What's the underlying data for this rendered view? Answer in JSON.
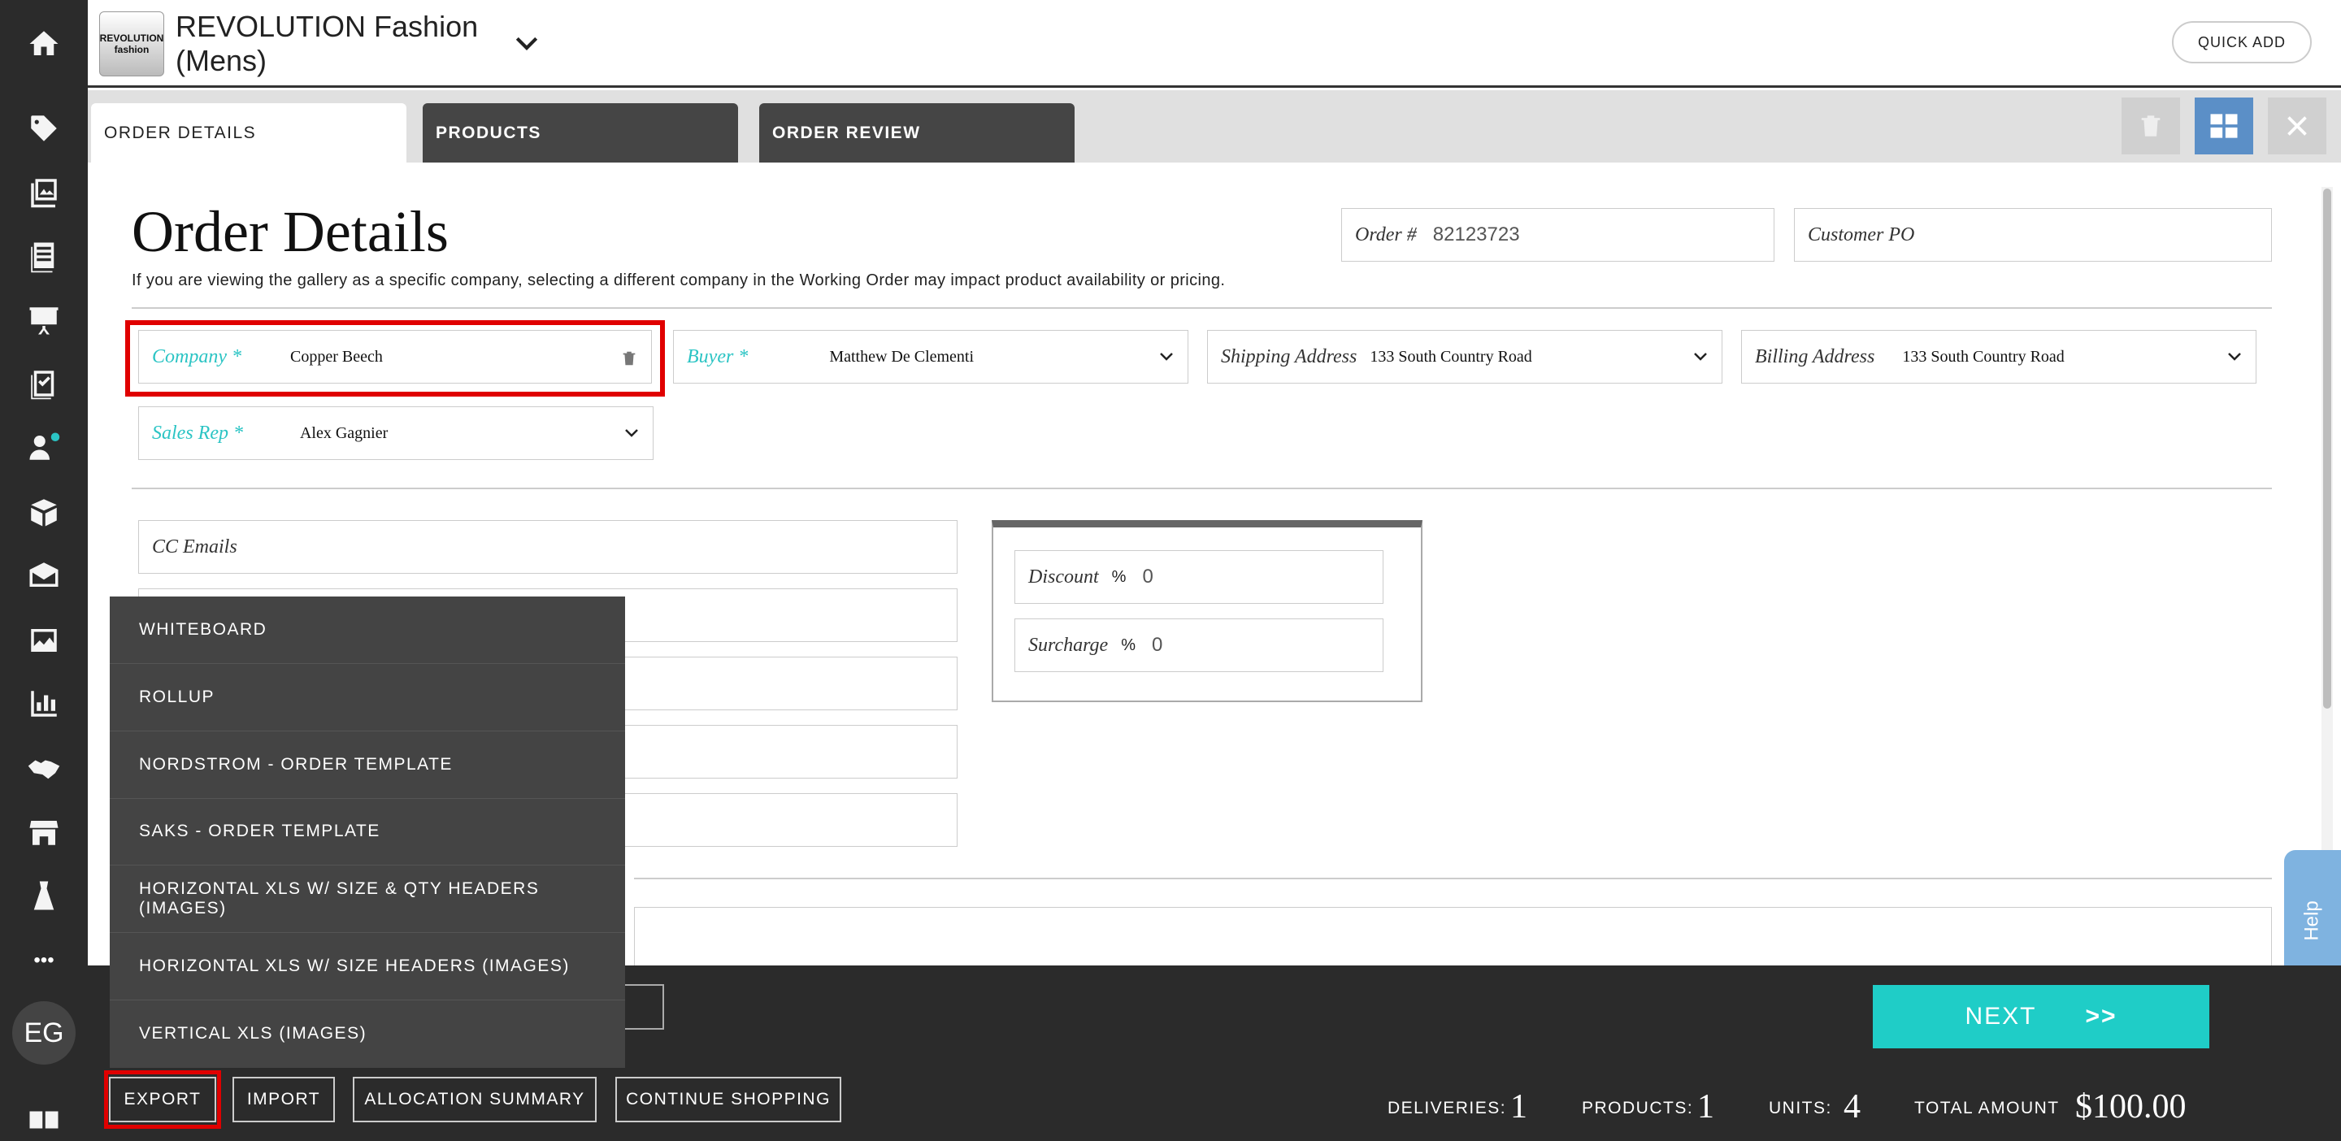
{
  "header": {
    "logo_line1": "REVOLUTION",
    "logo_line2": "fashion",
    "brand_line1": "REVOLUTION Fashion",
    "brand_line2": "(Mens)",
    "quick_add": "QUICK ADD"
  },
  "tabs": [
    {
      "label": "ORDER DETAILS",
      "active": true
    },
    {
      "label": "PRODUCTS",
      "active": false
    },
    {
      "label": "ORDER REVIEW",
      "active": false
    }
  ],
  "page": {
    "title": "Order Details",
    "subtitle": "If you are viewing the gallery as a specific company, selecting a different company in the Working Order may impact product availability or pricing."
  },
  "fields": {
    "order_no": {
      "label": "Order #",
      "value": "82123723"
    },
    "customer_po": {
      "label": "Customer PO",
      "value": ""
    },
    "company": {
      "label": "Company *",
      "value": "Copper Beech"
    },
    "buyer": {
      "label": "Buyer *",
      "value": "Matthew De Clementi"
    },
    "shipping": {
      "label": "Shipping Address",
      "value": "133 South Country Road"
    },
    "billing": {
      "label": "Billing Address",
      "value": "133 South Country Road"
    },
    "sales_rep": {
      "label": "Sales Rep *",
      "value": "Alex Gagnier"
    },
    "cc_emails": {
      "label": "CC Emails",
      "value": ""
    },
    "discount": {
      "label": "Discount",
      "unit": "%",
      "value": "0"
    },
    "surcharge": {
      "label": "Surcharge",
      "unit": "%",
      "value": "0"
    }
  },
  "export_menu": [
    "WHITEBOARD",
    "ROLLUP",
    "NORDSTROM - ORDER TEMPLATE",
    "SAKS - ORDER TEMPLATE",
    "HORIZONTAL XLS W/ SIZE & QTY HEADERS (IMAGES)",
    "HORIZONTAL XLS W/ SIZE HEADERS (IMAGES)",
    "VERTICAL XLS (IMAGES)"
  ],
  "footer": {
    "export": "EXPORT",
    "import": "IMPORT",
    "allocation": "ALLOCATION SUMMARY",
    "continue": "CONTINUE SHOPPING",
    "next": "NEXT",
    "next_icon": ">>",
    "deliveries_label": "DELIVERIES:",
    "deliveries_value": "1",
    "products_label": "PRODUCTS:",
    "products_value": "1",
    "units_label": "UNITS:",
    "units_value": "4",
    "total_label": "TOTAL AMOUNT",
    "total_value": "$100.00"
  },
  "rail": {
    "avatar": "EG",
    "more": "•••"
  },
  "help": "Help",
  "colors": {
    "accent_teal": "#1fcdc7",
    "required_label": "#2bc4c4",
    "highlight_red": "#e00000",
    "dark": "#2b2b2b",
    "help_blue": "#7fb3e0",
    "grid_button_blue": "#5b8fc7"
  },
  "icons": [
    "home-icon",
    "tag-icon",
    "gallery-icon",
    "catalog-icon",
    "presentation-icon",
    "checklist-icon",
    "customers-icon",
    "box-icon",
    "email-icon",
    "image-icon",
    "chart-icon",
    "handshake-icon",
    "store-icon",
    "dress-icon",
    "trash-icon",
    "grid-icon",
    "close-icon",
    "chevron-down-icon"
  ]
}
